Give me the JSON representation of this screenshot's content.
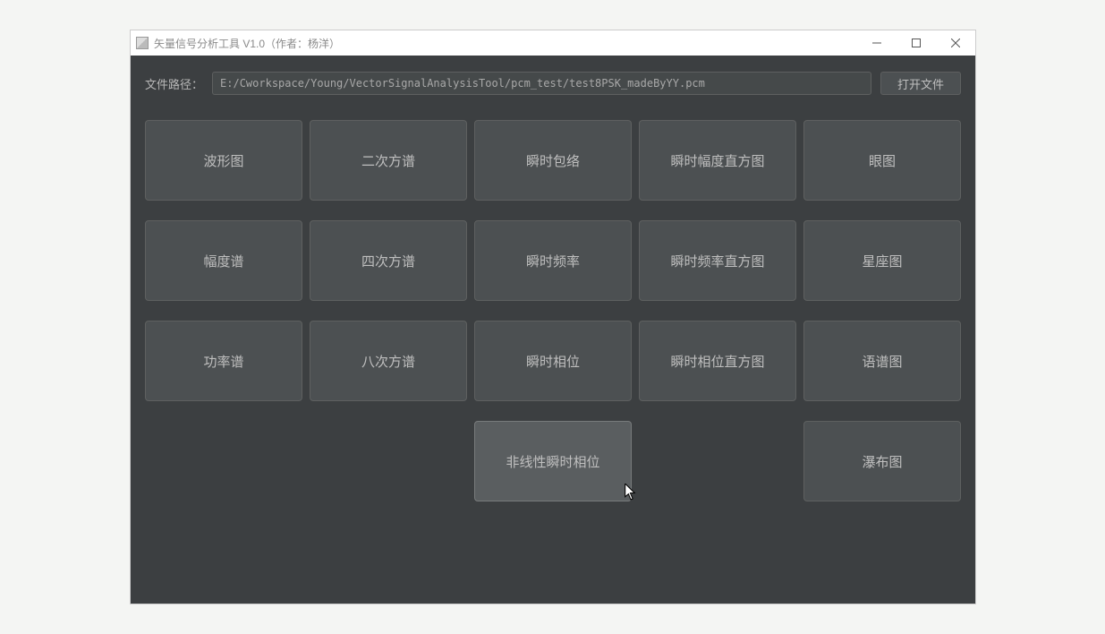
{
  "window": {
    "title": "矢量信号分析工具 V1.0（作者：杨洋）"
  },
  "fileRow": {
    "label": "文件路径：",
    "path": "E:/Cworkspace/Young/VectorSignalAnalysisTool/pcm_test/test8PSK_madeByYY.pcm",
    "openLabel": "打开文件"
  },
  "buttons": {
    "r0c0": "波形图",
    "r0c1": "二次方谱",
    "r0c2": "瞬时包络",
    "r0c3": "瞬时幅度直方图",
    "r0c4": "眼图",
    "r1c0": "幅度谱",
    "r1c1": "四次方谱",
    "r1c2": "瞬时频率",
    "r1c3": "瞬时频率直方图",
    "r1c4": "星座图",
    "r2c0": "功率谱",
    "r2c1": "八次方谱",
    "r2c2": "瞬时相位",
    "r2c3": "瞬时相位直方图",
    "r2c4": "语谱图",
    "r3c2": "非线性瞬时相位",
    "r3c4": "瀑布图"
  }
}
